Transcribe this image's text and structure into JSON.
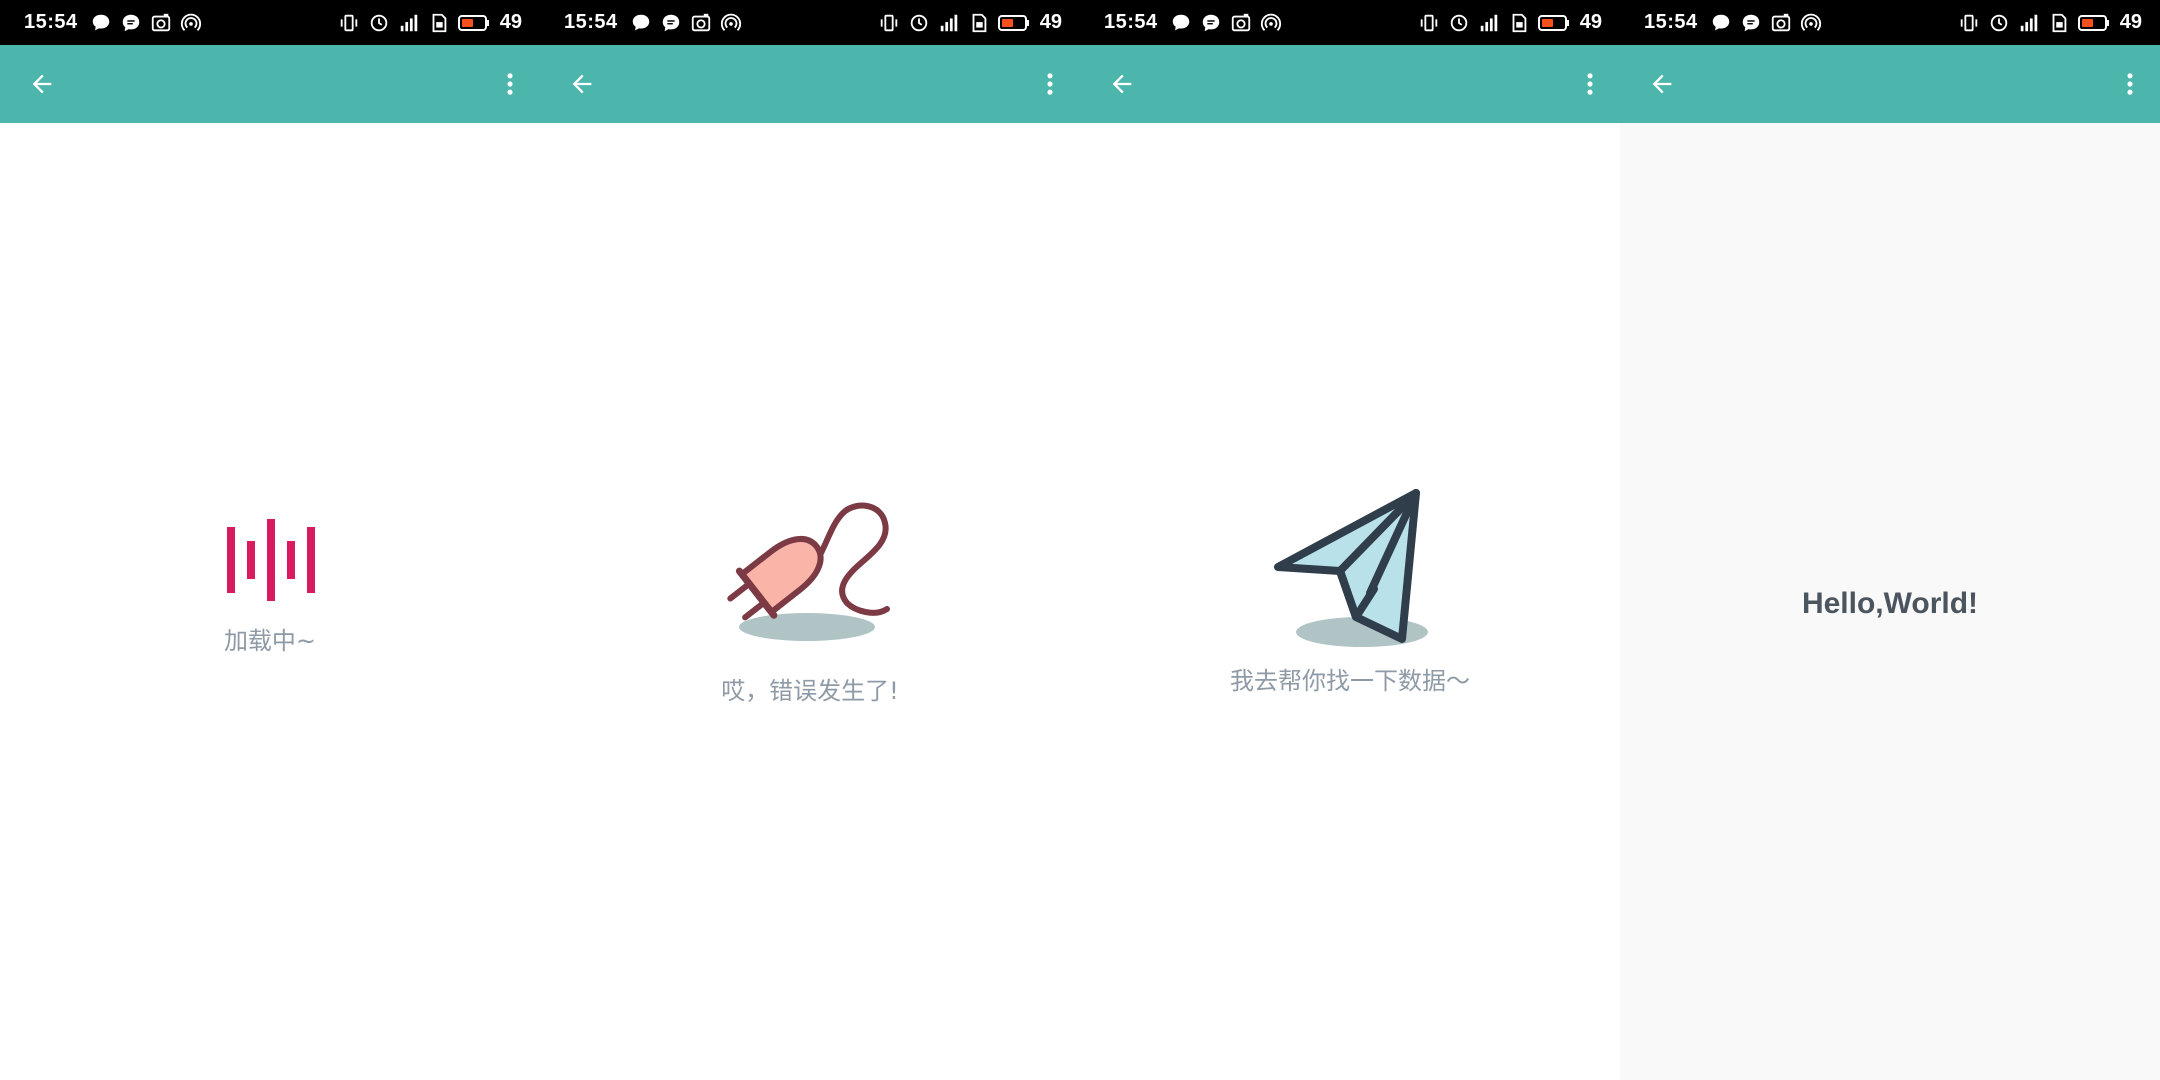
{
  "status_bar": {
    "time": "15:54",
    "battery_percent": "49",
    "left_icons": [
      "message-bubble-icon",
      "chat-bubble-icon",
      "camera-notify-icon",
      "hotspot-icon"
    ],
    "right_icons": [
      "vibrate-icon",
      "alarm-icon",
      "signal-icon",
      "sim-hd-icon",
      "battery-icon"
    ]
  },
  "app_bar": {
    "color": "#4db6ac",
    "back_icon": "arrow-back-icon",
    "menu_icon": "more-vert-icon"
  },
  "screens": [
    {
      "state": "loading",
      "illustration": "loading-bars-icon",
      "caption": "加载中~",
      "accent": "#d81b60"
    },
    {
      "state": "error",
      "illustration": "unplugged-plug-icon",
      "caption": "哎，错误发生了!",
      "accent": "#7b3a44"
    },
    {
      "state": "empty",
      "illustration": "paper-plane-icon",
      "caption": "我去帮你找一下数据〜",
      "accent": "#2f3e4a"
    },
    {
      "state": "content",
      "text": "Hello,World!"
    }
  ]
}
